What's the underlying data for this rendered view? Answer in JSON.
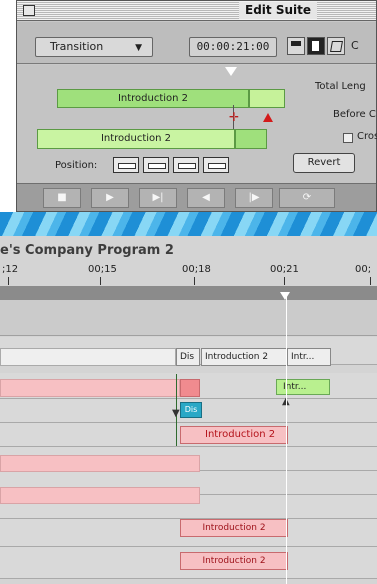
{
  "edit_suite": {
    "title": "Edit Suite",
    "transition_label": "Transition",
    "timecode": "00:00:21:00",
    "overflow_char": "C",
    "clip_a_label": "Introduction 2",
    "clip_b_label": "Introduction 2",
    "position_label": "Position:",
    "total_length_label": "Total Leng",
    "before_label": "Before C",
    "cross_label": "Cross",
    "revert_label": "Revert"
  },
  "transport": {
    "stop": "■",
    "play": "▶",
    "play_next": "▶|",
    "back": "◀",
    "forward": "|▶",
    "loop": "⟳"
  },
  "timeline": {
    "program_title": "e's Company Program 2",
    "ticks": [
      ";12",
      "00;15",
      "00;18",
      "00;21",
      "00;"
    ],
    "clips": {
      "diss_label": "Dis",
      "intro_label": "Introduction 2",
      "intr_label": "Intr...",
      "intr_green": "Intr...",
      "cyan_label": "Dis",
      "intro_red": "Introduction 2",
      "intro_r2": "Introduction 2",
      "intro_r3": "Introduction 2"
    }
  }
}
